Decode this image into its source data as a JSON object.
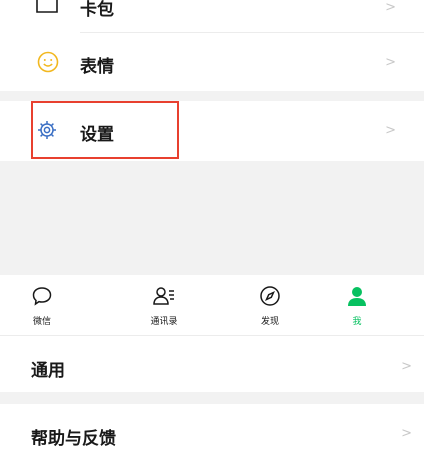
{
  "menu": {
    "items": [
      {
        "label": "卡包",
        "icon": "card-icon",
        "chevron": ">"
      },
      {
        "label": "表情",
        "icon": "smiley-icon",
        "chevron": ">"
      },
      {
        "label": "设置",
        "icon": "gear-icon",
        "chevron": ">"
      }
    ]
  },
  "tabbar": {
    "tabs": [
      {
        "label": "微信",
        "icon": "chat-bubble-icon"
      },
      {
        "label": "通讯录",
        "icon": "contacts-icon"
      },
      {
        "label": "发现",
        "icon": "compass-icon"
      },
      {
        "label": "我",
        "icon": "person-icon",
        "active": true
      }
    ]
  },
  "settings": {
    "items": [
      {
        "label": "通用",
        "chevron": ">"
      },
      {
        "label": "帮助与反馈",
        "chevron": ">"
      }
    ]
  },
  "colors": {
    "accent": "#07c160",
    "highlight": "#e8402f",
    "separator": "#f2f2f2"
  }
}
